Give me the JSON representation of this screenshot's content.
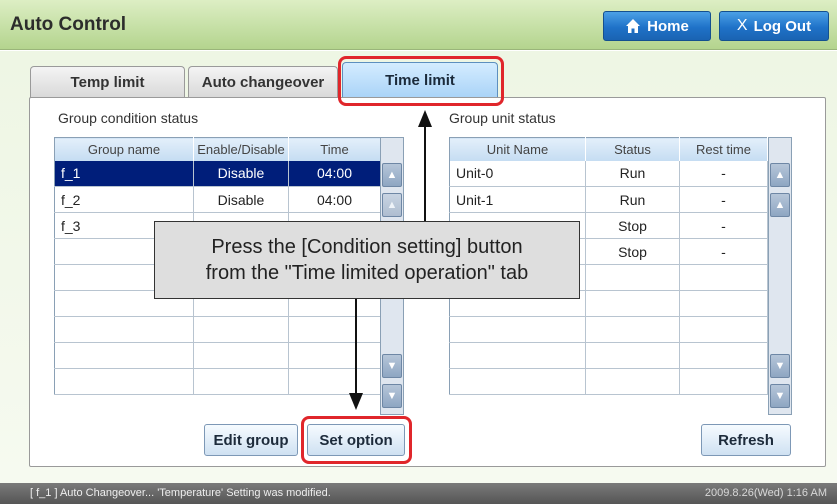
{
  "app": {
    "title": "Auto Control"
  },
  "header": {
    "home_label": "Home",
    "logout_label": "Log Out"
  },
  "tabs": [
    {
      "label": "Temp limit",
      "active": false
    },
    {
      "label": "Auto changeover",
      "active": false
    },
    {
      "label": "Time limit",
      "active": true
    }
  ],
  "group_condition": {
    "title": "Group condition status",
    "columns": [
      "Group name",
      "Enable/Disable",
      "Time"
    ],
    "rows": [
      {
        "name": "f_1",
        "enable": "Disable",
        "time": "04:00",
        "selected": true
      },
      {
        "name": "f_2",
        "enable": "Disable",
        "time": "04:00",
        "selected": false
      },
      {
        "name": "f_3",
        "enable": "",
        "time": "",
        "selected": false
      }
    ]
  },
  "group_unit": {
    "title": "Group unit status",
    "columns": [
      "Unit Name",
      "Status",
      "Rest time"
    ],
    "rows": [
      {
        "name": "Unit-0",
        "status": "Run",
        "rest": "-"
      },
      {
        "name": "Unit-1",
        "status": "Run",
        "rest": "-"
      },
      {
        "name": "",
        "status": "Stop",
        "rest": "-"
      },
      {
        "name": "",
        "status": "Stop",
        "rest": "-"
      }
    ]
  },
  "buttons": {
    "edit_group": "Edit group",
    "set_option": "Set option",
    "refresh": "Refresh"
  },
  "callout": {
    "line1": "Press the [Condition setting] button",
    "line2": "from the \"Time limited operation\" tab"
  },
  "status_bar": {
    "message": "[ f_1 ] Auto Changeover... 'Temperature' Setting was modified.",
    "datetime": "2009.8.26(Wed)  1:16 AM"
  },
  "colors": {
    "titlebar": "#c6e0a6",
    "selected_row": "#001e7a",
    "highlight": "#e0262b",
    "primary_button": "#1f72c8"
  },
  "icons": {
    "home": "home-icon",
    "logout": "x-icon",
    "scroll_top": "double-up-arrow-icon",
    "scroll_up": "up-arrow-icon",
    "scroll_down": "down-arrow-icon",
    "scroll_bottom": "double-down-arrow-icon"
  }
}
